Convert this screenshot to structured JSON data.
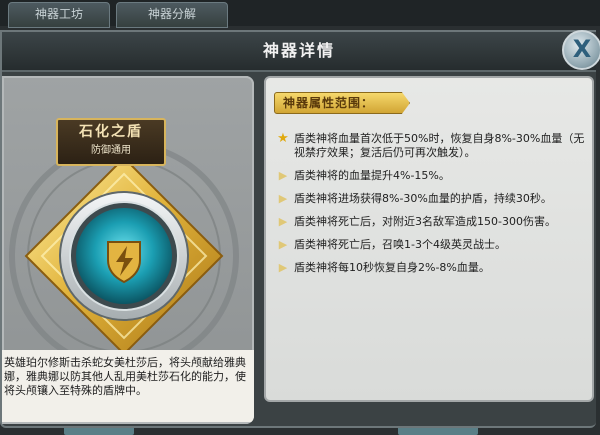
{
  "background": {
    "tabs": [
      "神器工坊",
      "神器分解"
    ]
  },
  "dialog": {
    "title": "神器详情",
    "close_label": "X"
  },
  "artifact": {
    "name": "石化之盾",
    "subtitle": "防御通用",
    "description": "英雄珀尔修斯击杀蛇女美杜莎后，将头颅献给雅典娜，雅典娜以防其他人乱用美杜莎石化的能力，使将头颅镶入至特殊的盾牌中。"
  },
  "attributes": {
    "header": "神器属性范围：",
    "items": [
      {
        "icon": "star-icon",
        "text": "盾类神将血量首次低于50%时，恢复自身8%-30%血量（无视禁疗效果；复活后仍可再次触发）。"
      },
      {
        "icon": "triangle-bullet-icon",
        "text": "盾类神将的血量提升4%-15%。"
      },
      {
        "icon": "triangle-bullet-icon",
        "text": "盾类神将进场获得8%-30%血量的护盾，持续30秒。"
      },
      {
        "icon": "triangle-bullet-icon",
        "text": "盾类神将死亡后，对附近3名敌军造成150-300伤害。"
      },
      {
        "icon": "triangle-bullet-icon",
        "text": "盾类神将死亡后，召唤1-3个4级英灵战士。"
      },
      {
        "icon": "triangle-bullet-icon",
        "text": "盾类神将每10秒恢复自身2%-8%血量。"
      }
    ]
  },
  "colors": {
    "gold": "#d7b45c",
    "teal_gem": "#1ea7b8",
    "panel_bg": "#e4e5e3"
  }
}
